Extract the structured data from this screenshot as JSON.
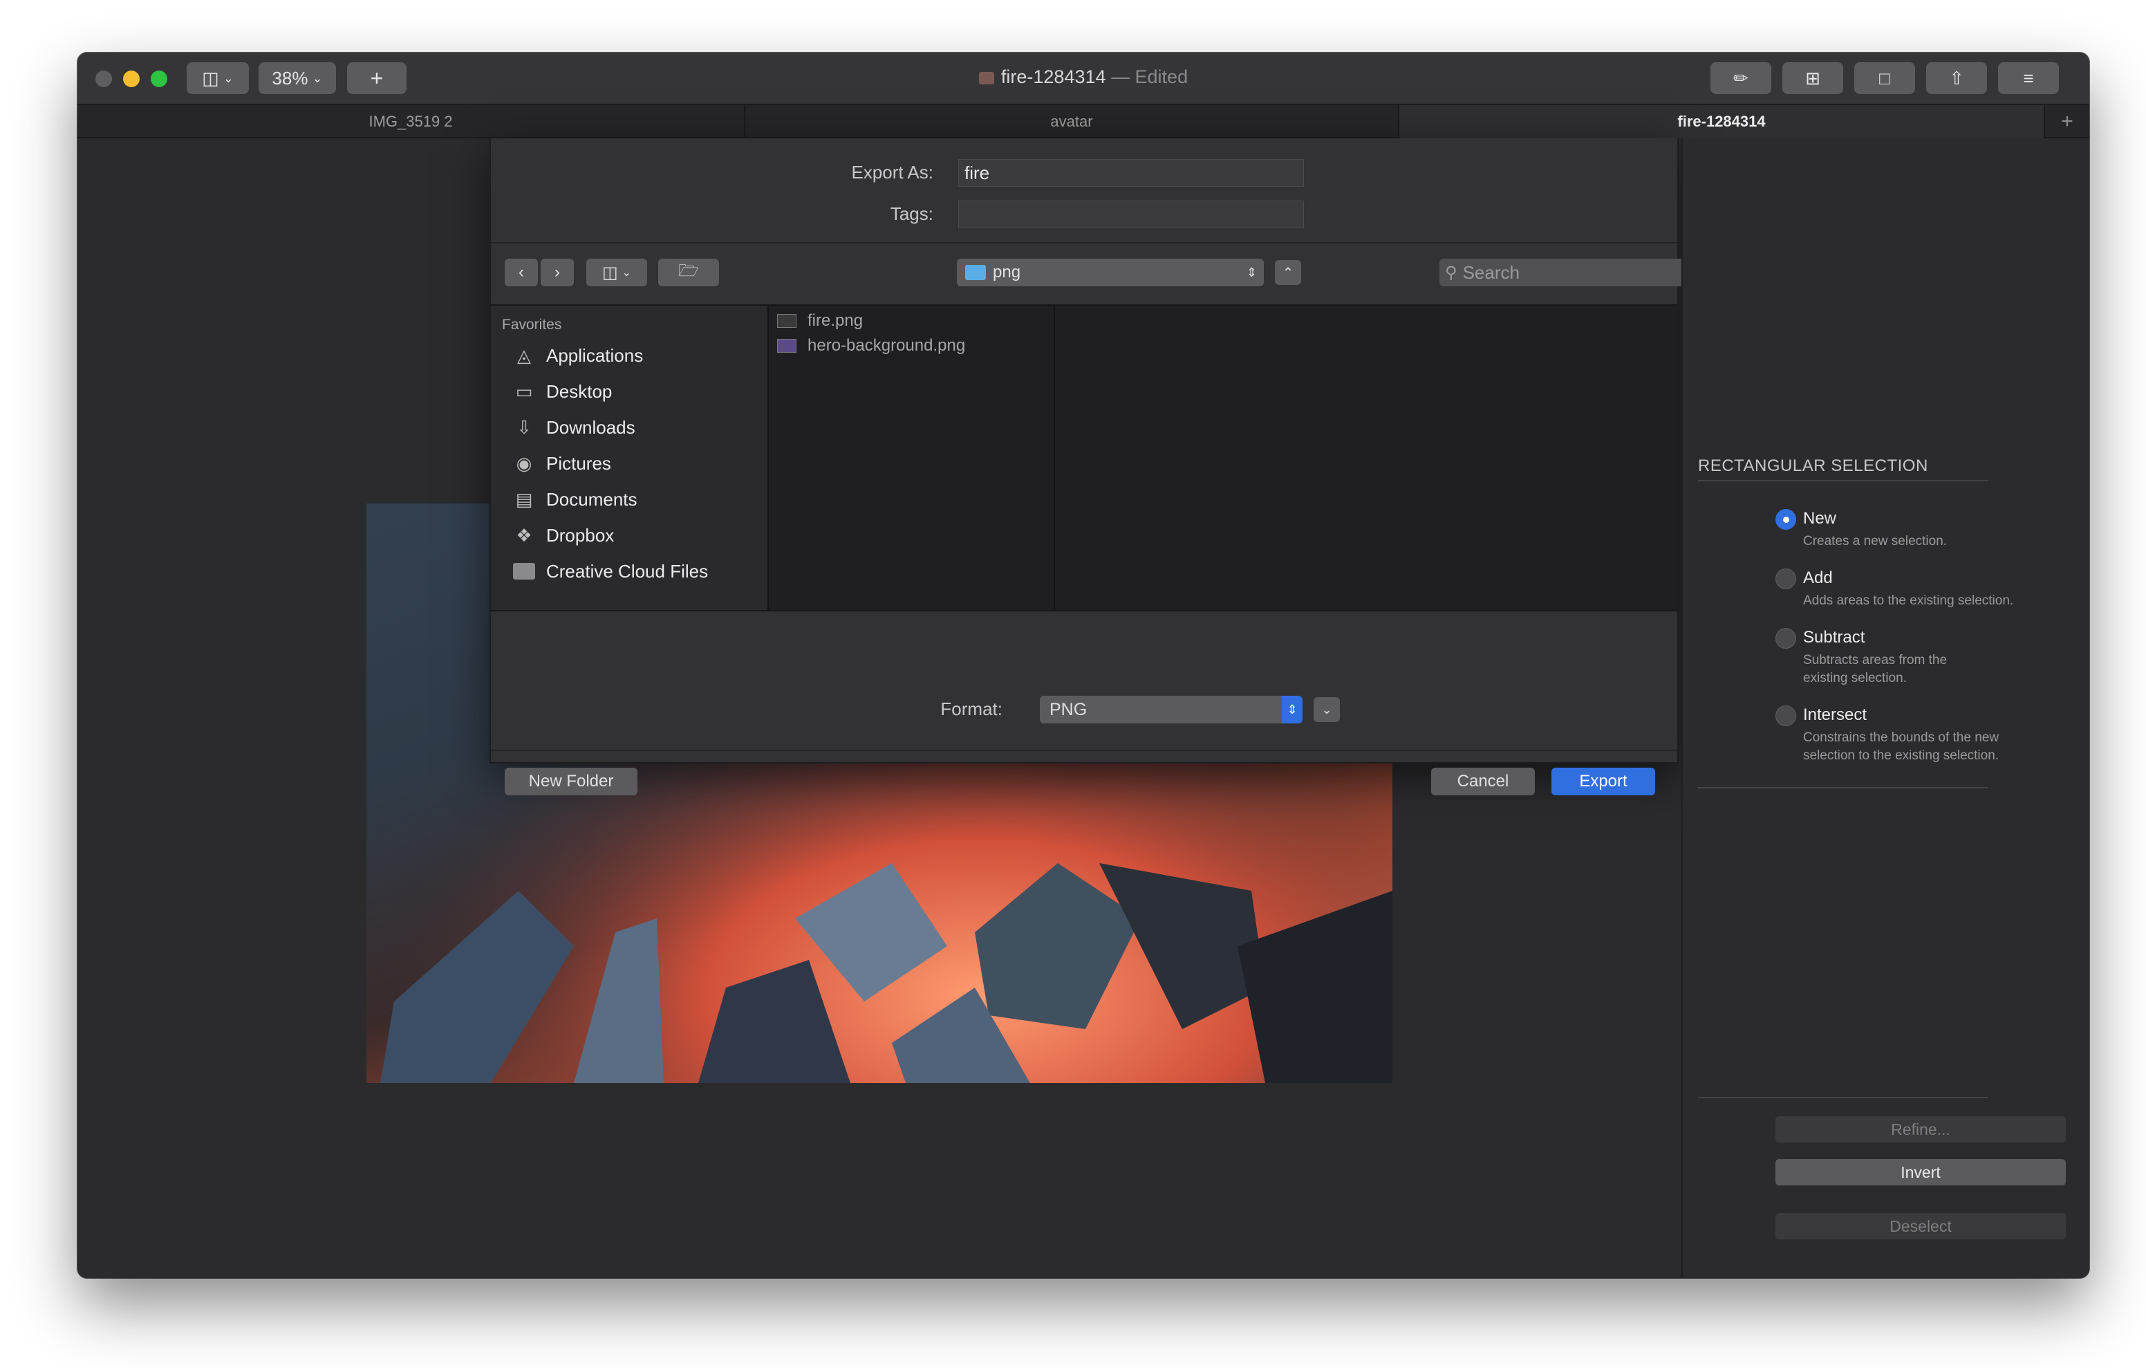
{
  "window": {
    "title": "fire-1284314",
    "title_suffix": "— Edited",
    "zoom": "38%",
    "add_label": "+"
  },
  "tabs": [
    {
      "label": "IMG_3519 2",
      "active": false
    },
    {
      "label": "avatar",
      "active": false
    },
    {
      "label": "fire-1284314",
      "active": true
    }
  ],
  "export_dialog": {
    "export_as_label": "Export As:",
    "export_as_value": "fire",
    "tags_label": "Tags:",
    "tags_value": "",
    "folder": "png",
    "search_placeholder": "Search",
    "favorites_header": "Favorites",
    "favorites": [
      {
        "label": "Applications",
        "icon": "applications-icon"
      },
      {
        "label": "Desktop",
        "icon": "desktop-icon"
      },
      {
        "label": "Downloads",
        "icon": "downloads-icon"
      },
      {
        "label": "Pictures",
        "icon": "pictures-icon"
      },
      {
        "label": "Documents",
        "icon": "documents-icon"
      },
      {
        "label": "Dropbox",
        "icon": "dropbox-icon"
      },
      {
        "label": "Creative Cloud Files",
        "icon": "folder-icon"
      }
    ],
    "files": [
      {
        "name": "fire.png"
      },
      {
        "name": "hero-background.png"
      }
    ],
    "format_label": "Format:",
    "format_value": "PNG",
    "new_folder_label": "New Folder",
    "cancel_label": "Cancel",
    "export_label": "Export"
  },
  "selection_panel": {
    "header": "RECTANGULAR SELECTION",
    "options": [
      {
        "title": "New",
        "desc": "Creates a new selection.",
        "selected": true
      },
      {
        "title": "Add",
        "desc": "Adds areas to the existing selection.",
        "selected": false
      },
      {
        "title": "Subtract",
        "desc": "Subtracts areas from the existing selection.",
        "selected": false
      },
      {
        "title": "Intersect",
        "desc": "Constrains the bounds of the new selection to the existing selection.",
        "selected": false
      }
    ],
    "refine_label": "Refine...",
    "invert_label": "Invert",
    "deselect_label": "Deselect"
  },
  "colors": {
    "accent": "#2f6fe0",
    "window_bg": "#2b2b2d",
    "dialog_bg": "#323234"
  }
}
